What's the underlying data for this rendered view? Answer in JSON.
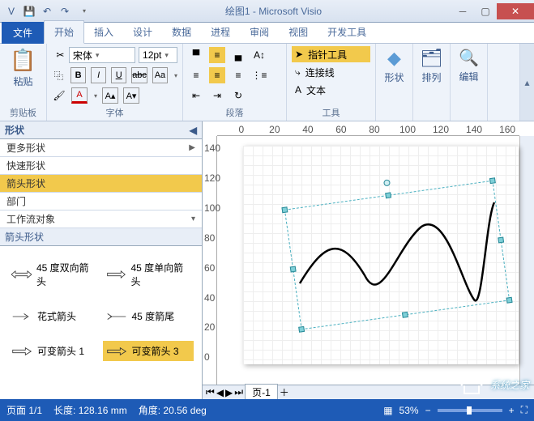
{
  "titlebar": {
    "title": "绘图1 - Microsoft Visio"
  },
  "qat": {
    "icon": "V"
  },
  "tabs": {
    "file": "文件",
    "home": "开始",
    "insert": "插入",
    "design": "设计",
    "data": "数据",
    "process": "进程",
    "review": "审阅",
    "view": "视图",
    "dev": "开发工具"
  },
  "ribbon": {
    "clipboard": {
      "label": "剪贴板",
      "paste": "粘贴"
    },
    "font": {
      "label": "字体",
      "family": "宋体",
      "size": "12pt",
      "bold": "B",
      "italic": "I",
      "underline": "U",
      "strike": "abc",
      "super": "Aa"
    },
    "para": {
      "label": "段落"
    },
    "tools": {
      "label": "工具",
      "pointer": "指针工具",
      "connector": "连接线",
      "text": "文本"
    },
    "shape": {
      "label": "形状"
    },
    "arrange": {
      "label": "排列"
    },
    "edit": {
      "label": "编辑"
    }
  },
  "shapes": {
    "header": "形状",
    "rows": {
      "more": "更多形状",
      "quick": "快速形状",
      "arrow": "箭头形状",
      "dept": "部门",
      "workflow": "工作流对象"
    },
    "subheader": "箭头形状",
    "items": {
      "a1": "45 度双向箭头",
      "a2": "45 度单向箭头",
      "a3": "花式箭头",
      "a4": "45 度箭尾",
      "a5": "可变箭头 1",
      "a6": "可变箭头 3"
    }
  },
  "ruler": {
    "h": [
      "0",
      "20",
      "40",
      "60",
      "80",
      "100",
      "120",
      "140",
      "160"
    ],
    "v": [
      "140",
      "120",
      "100",
      "80",
      "60",
      "40",
      "20",
      "0"
    ]
  },
  "pagetabs": {
    "page1": "页-1"
  },
  "status": {
    "page": "页面 1/1",
    "length": "长度: 128.16 mm",
    "angle": "角度: 20.56 deg",
    "zoom": "53%"
  },
  "watermark": "系统之家"
}
